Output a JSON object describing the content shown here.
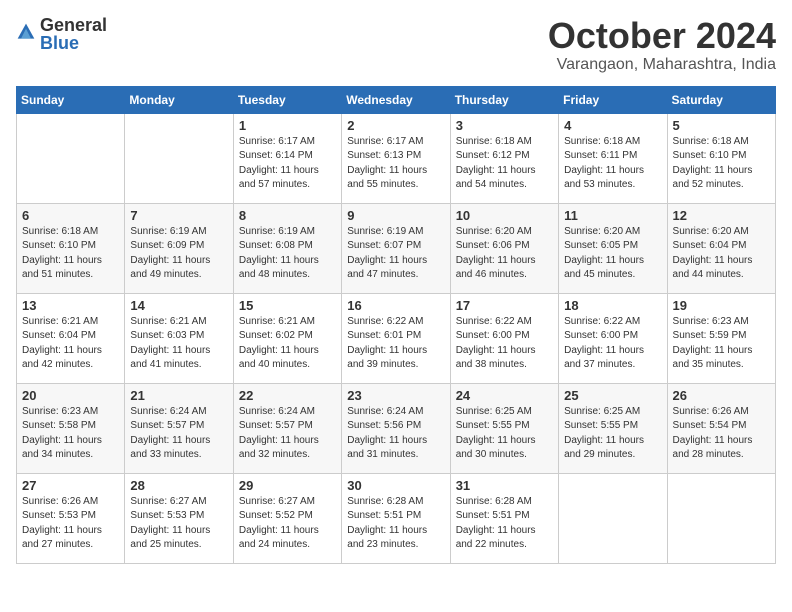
{
  "logo": {
    "general": "General",
    "blue": "Blue"
  },
  "title": "October 2024",
  "location": "Varangaon, Maharashtra, India",
  "days_of_week": [
    "Sunday",
    "Monday",
    "Tuesday",
    "Wednesday",
    "Thursday",
    "Friday",
    "Saturday"
  ],
  "weeks": [
    [
      {
        "day": "",
        "info": ""
      },
      {
        "day": "",
        "info": ""
      },
      {
        "day": "1",
        "info": "Sunrise: 6:17 AM\nSunset: 6:14 PM\nDaylight: 11 hours and 57 minutes."
      },
      {
        "day": "2",
        "info": "Sunrise: 6:17 AM\nSunset: 6:13 PM\nDaylight: 11 hours and 55 minutes."
      },
      {
        "day": "3",
        "info": "Sunrise: 6:18 AM\nSunset: 6:12 PM\nDaylight: 11 hours and 54 minutes."
      },
      {
        "day": "4",
        "info": "Sunrise: 6:18 AM\nSunset: 6:11 PM\nDaylight: 11 hours and 53 minutes."
      },
      {
        "day": "5",
        "info": "Sunrise: 6:18 AM\nSunset: 6:10 PM\nDaylight: 11 hours and 52 minutes."
      }
    ],
    [
      {
        "day": "6",
        "info": "Sunrise: 6:18 AM\nSunset: 6:10 PM\nDaylight: 11 hours and 51 minutes."
      },
      {
        "day": "7",
        "info": "Sunrise: 6:19 AM\nSunset: 6:09 PM\nDaylight: 11 hours and 49 minutes."
      },
      {
        "day": "8",
        "info": "Sunrise: 6:19 AM\nSunset: 6:08 PM\nDaylight: 11 hours and 48 minutes."
      },
      {
        "day": "9",
        "info": "Sunrise: 6:19 AM\nSunset: 6:07 PM\nDaylight: 11 hours and 47 minutes."
      },
      {
        "day": "10",
        "info": "Sunrise: 6:20 AM\nSunset: 6:06 PM\nDaylight: 11 hours and 46 minutes."
      },
      {
        "day": "11",
        "info": "Sunrise: 6:20 AM\nSunset: 6:05 PM\nDaylight: 11 hours and 45 minutes."
      },
      {
        "day": "12",
        "info": "Sunrise: 6:20 AM\nSunset: 6:04 PM\nDaylight: 11 hours and 44 minutes."
      }
    ],
    [
      {
        "day": "13",
        "info": "Sunrise: 6:21 AM\nSunset: 6:04 PM\nDaylight: 11 hours and 42 minutes."
      },
      {
        "day": "14",
        "info": "Sunrise: 6:21 AM\nSunset: 6:03 PM\nDaylight: 11 hours and 41 minutes."
      },
      {
        "day": "15",
        "info": "Sunrise: 6:21 AM\nSunset: 6:02 PM\nDaylight: 11 hours and 40 minutes."
      },
      {
        "day": "16",
        "info": "Sunrise: 6:22 AM\nSunset: 6:01 PM\nDaylight: 11 hours and 39 minutes."
      },
      {
        "day": "17",
        "info": "Sunrise: 6:22 AM\nSunset: 6:00 PM\nDaylight: 11 hours and 38 minutes."
      },
      {
        "day": "18",
        "info": "Sunrise: 6:22 AM\nSunset: 6:00 PM\nDaylight: 11 hours and 37 minutes."
      },
      {
        "day": "19",
        "info": "Sunrise: 6:23 AM\nSunset: 5:59 PM\nDaylight: 11 hours and 35 minutes."
      }
    ],
    [
      {
        "day": "20",
        "info": "Sunrise: 6:23 AM\nSunset: 5:58 PM\nDaylight: 11 hours and 34 minutes."
      },
      {
        "day": "21",
        "info": "Sunrise: 6:24 AM\nSunset: 5:57 PM\nDaylight: 11 hours and 33 minutes."
      },
      {
        "day": "22",
        "info": "Sunrise: 6:24 AM\nSunset: 5:57 PM\nDaylight: 11 hours and 32 minutes."
      },
      {
        "day": "23",
        "info": "Sunrise: 6:24 AM\nSunset: 5:56 PM\nDaylight: 11 hours and 31 minutes."
      },
      {
        "day": "24",
        "info": "Sunrise: 6:25 AM\nSunset: 5:55 PM\nDaylight: 11 hours and 30 minutes."
      },
      {
        "day": "25",
        "info": "Sunrise: 6:25 AM\nSunset: 5:55 PM\nDaylight: 11 hours and 29 minutes."
      },
      {
        "day": "26",
        "info": "Sunrise: 6:26 AM\nSunset: 5:54 PM\nDaylight: 11 hours and 28 minutes."
      }
    ],
    [
      {
        "day": "27",
        "info": "Sunrise: 6:26 AM\nSunset: 5:53 PM\nDaylight: 11 hours and 27 minutes."
      },
      {
        "day": "28",
        "info": "Sunrise: 6:27 AM\nSunset: 5:53 PM\nDaylight: 11 hours and 25 minutes."
      },
      {
        "day": "29",
        "info": "Sunrise: 6:27 AM\nSunset: 5:52 PM\nDaylight: 11 hours and 24 minutes."
      },
      {
        "day": "30",
        "info": "Sunrise: 6:28 AM\nSunset: 5:51 PM\nDaylight: 11 hours and 23 minutes."
      },
      {
        "day": "31",
        "info": "Sunrise: 6:28 AM\nSunset: 5:51 PM\nDaylight: 11 hours and 22 minutes."
      },
      {
        "day": "",
        "info": ""
      },
      {
        "day": "",
        "info": ""
      }
    ]
  ]
}
